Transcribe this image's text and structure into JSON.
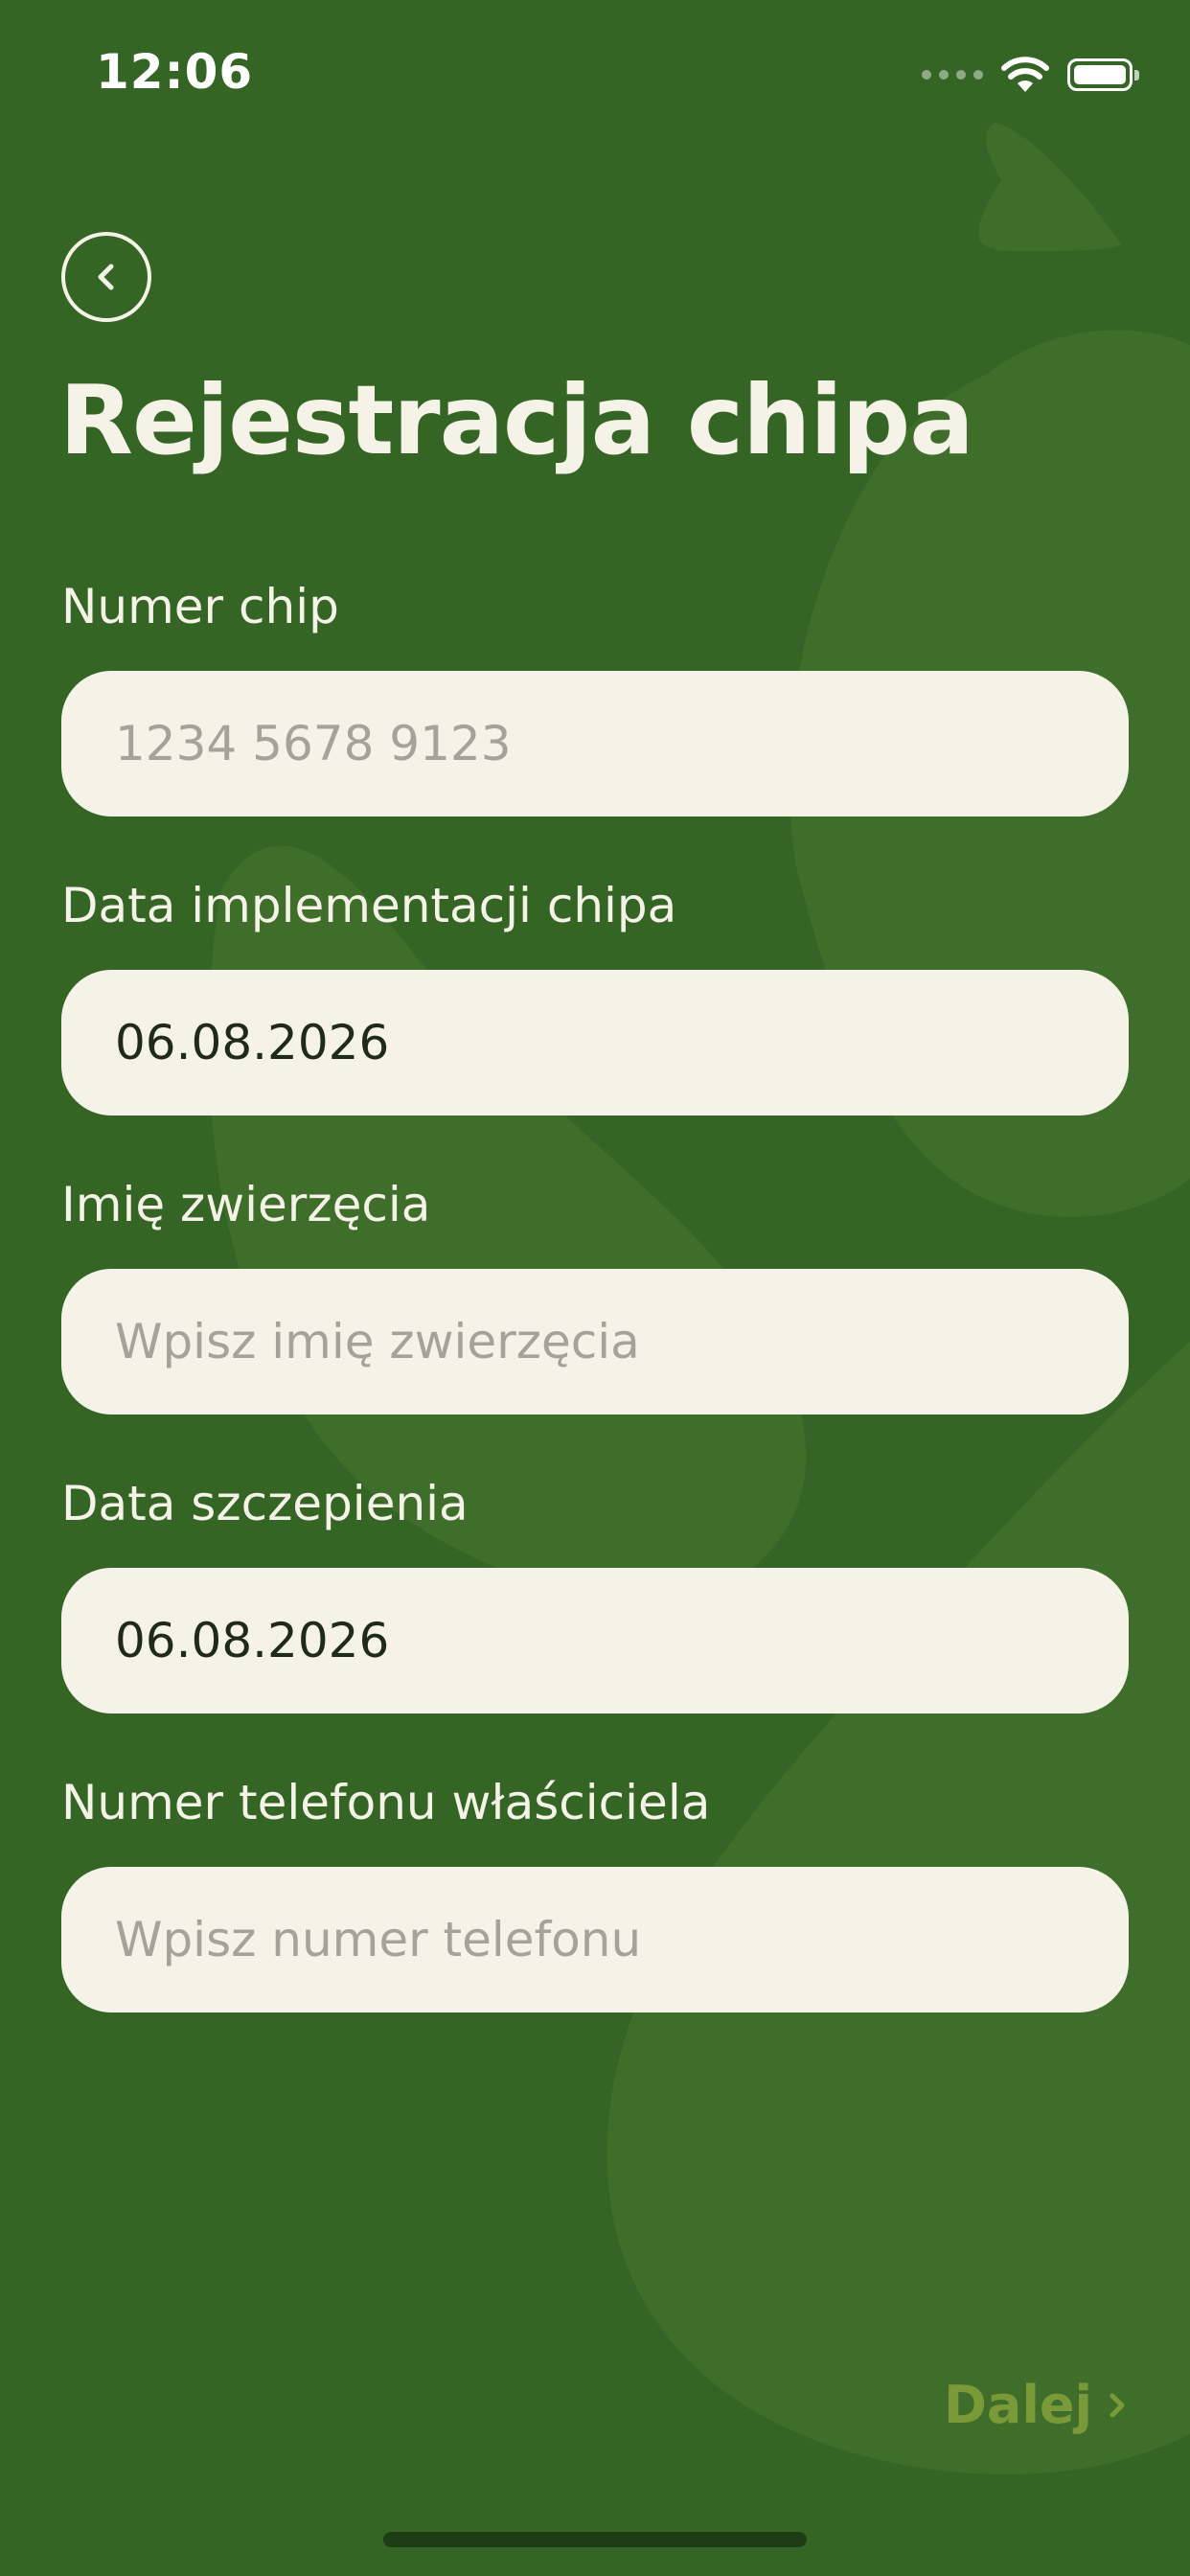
{
  "status_bar": {
    "time": "12:06"
  },
  "header": {
    "back_icon": "chevron-left-icon",
    "title": "Rejestracja chipa"
  },
  "form": {
    "chip_number": {
      "label": "Numer chip",
      "placeholder": "1234 5678 9123",
      "value": ""
    },
    "implant_date": {
      "label": "Data implementacji chipa",
      "value": "06.08.2026"
    },
    "pet_name": {
      "label": "Imię zwierzęcia",
      "placeholder": "Wpisz imię zwierzęcia",
      "value": ""
    },
    "vaccination_date": {
      "label": "Data szczepienia",
      "value": "06.08.2026"
    },
    "owner_phone": {
      "label": "Numer telefonu właściciela",
      "placeholder": "Wpisz numer telefonu",
      "value": ""
    }
  },
  "footer": {
    "next_label": "Dalej",
    "next_icon": "chevron-right-icon"
  },
  "colors": {
    "background": "#346524",
    "blob": "#3f6e2a",
    "field_background": "#f5f3e7",
    "label_text": "#f5f3e7",
    "placeholder_text": "#a3a39c",
    "next_button": "#7a9a3a"
  }
}
